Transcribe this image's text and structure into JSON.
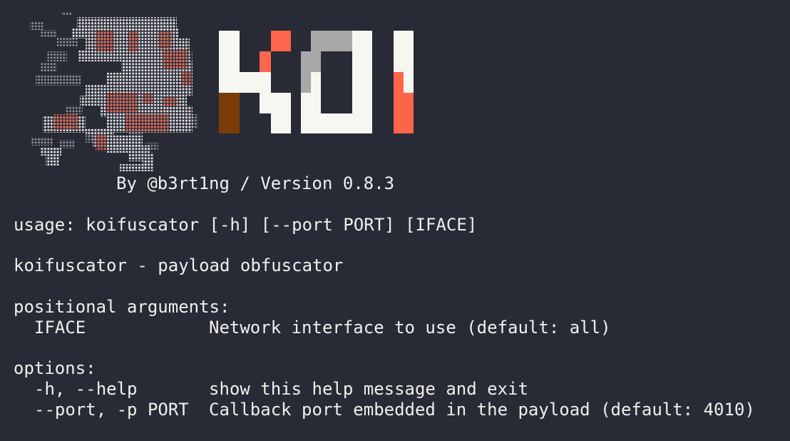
{
  "terminal": {
    "background": "#282a36",
    "foreground": "#f0f0ec"
  },
  "banner": {
    "logo_text": "KOI",
    "logo_colors": {
      "white": "#f7f7f2",
      "coral": "#ff654a",
      "gray": "#a8a8a8",
      "brown": "#7a3d0a"
    },
    "byline": "By @b3rt1ng / Version 0.8.3"
  },
  "help": {
    "usage": "usage: koifuscator [-h] [--port PORT] [IFACE]",
    "description": "koifuscator - payload obfuscator",
    "positional_header": "positional arguments:",
    "positional": [
      {
        "name": "IFACE",
        "help": "Network interface to use (default: all)"
      }
    ],
    "options_header": "options:",
    "options": [
      {
        "name": "-h, --help",
        "help": "show this help message and exit"
      },
      {
        "name": "--port, -p PORT",
        "help": "Callback port embedded in the payload (default: 4010)"
      }
    ]
  }
}
